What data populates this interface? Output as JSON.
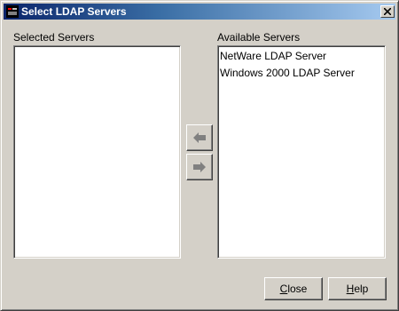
{
  "window": {
    "title": "Select LDAP Servers",
    "titlebar_colors": [
      "#0a246a",
      "#a6caf0"
    ]
  },
  "selected_servers": {
    "label": "Selected Servers",
    "items": []
  },
  "available_servers": {
    "label": "Available Servers",
    "items": [
      {
        "label": "NetWare LDAP Server"
      },
      {
        "label": "Windows 2000 LDAP Server"
      }
    ]
  },
  "transfer_buttons": {
    "remove_icon": "arrow-left-icon",
    "add_icon": "arrow-right-icon",
    "enabled": false
  },
  "footer": {
    "close_label": "Close",
    "close_mnemonic": "C",
    "help_label": "Help",
    "help_mnemonic": "H"
  }
}
